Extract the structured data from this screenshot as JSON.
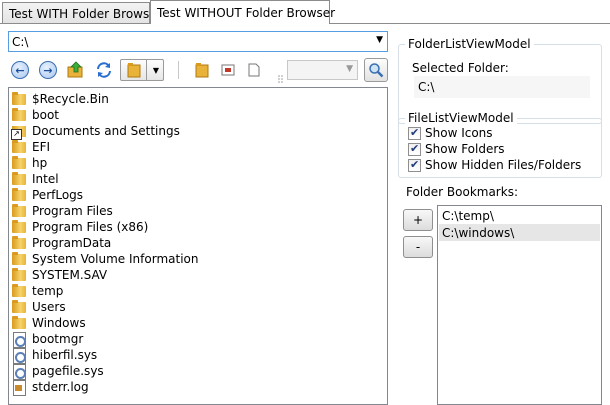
{
  "tabs": [
    {
      "label": "Test WITH Folder Browser",
      "active": false
    },
    {
      "label": "Test WITHOUT Folder Browser",
      "active": true
    }
  ],
  "address": {
    "value": "C:\\"
  },
  "toolbar": {
    "back_icon": "back-arrow-icon",
    "forward_icon": "forward-arrow-icon",
    "up_icon": "folder-up-icon",
    "refresh_icon": "refresh-icon",
    "view_icon": "folder-view-icon",
    "search_icon": "magnifier-icon"
  },
  "files": [
    {
      "name": "$Recycle.Bin",
      "type": "folder"
    },
    {
      "name": "boot",
      "type": "folder"
    },
    {
      "name": "Documents and Settings",
      "type": "link"
    },
    {
      "name": "EFI",
      "type": "folder"
    },
    {
      "name": "hp",
      "type": "folder"
    },
    {
      "name": "Intel",
      "type": "folder"
    },
    {
      "name": "PerfLogs",
      "type": "folder"
    },
    {
      "name": "Program Files",
      "type": "folder"
    },
    {
      "name": "Program Files (x86)",
      "type": "folder"
    },
    {
      "name": "ProgramData",
      "type": "folder"
    },
    {
      "name": "System Volume Information",
      "type": "folder"
    },
    {
      "name": "SYSTEM.SAV",
      "type": "folder"
    },
    {
      "name": "temp",
      "type": "folder"
    },
    {
      "name": "Users",
      "type": "folder"
    },
    {
      "name": "Windows",
      "type": "folder"
    },
    {
      "name": "bootmgr",
      "type": "sys"
    },
    {
      "name": "hiberfil.sys",
      "type": "sys"
    },
    {
      "name": "pagefile.sys",
      "type": "sys"
    },
    {
      "name": "stderr.log",
      "type": "log"
    }
  ],
  "folder_list_vm": {
    "group_label": "FolderListViewModel",
    "selected_label": "Selected Folder:",
    "selected_value": "C:\\"
  },
  "file_list_vm": {
    "group_label": "FileListViewModel",
    "options": [
      {
        "label": "Show Icons",
        "checked": true
      },
      {
        "label": "Show Folders",
        "checked": true
      },
      {
        "label": "Show Hidden Files/Folders",
        "checked": true
      }
    ]
  },
  "bookmarks": {
    "label": "Folder Bookmarks:",
    "add_label": "+",
    "remove_label": "-",
    "items": [
      {
        "path": "C:\\temp\\",
        "selected": false
      },
      {
        "path": "C:\\windows\\",
        "selected": true
      }
    ]
  }
}
